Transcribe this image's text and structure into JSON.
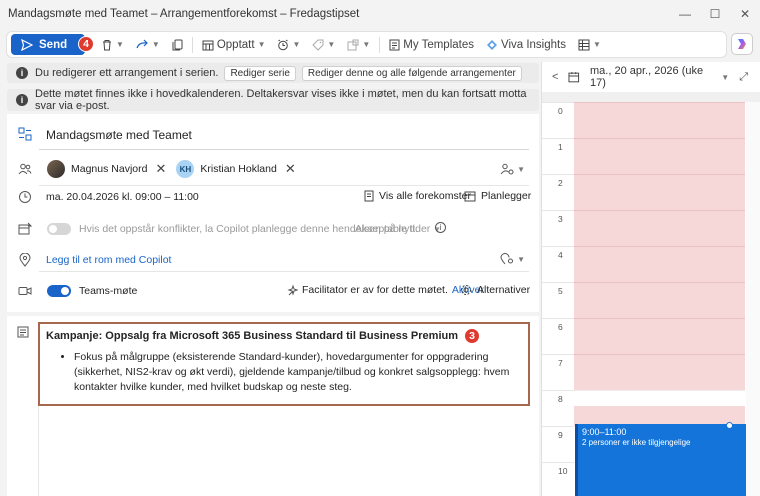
{
  "window": {
    "title": "Mandagsmøte med Teamet – Arrangementforekomst – Fredagstipset",
    "min": "—",
    "max": "☐",
    "close": "✕"
  },
  "toolbar": {
    "send_label": "Send",
    "send_badge": "4",
    "opptatt_label": "Opptatt",
    "my_templates_label": "My Templates",
    "viva_insights_label": "Viva Insights"
  },
  "notices": {
    "series_text": "Du redigerer ett arrangement i serien.",
    "edit_series_btn": "Rediger serie",
    "edit_following_btn": "Rediger denne og alle følgende arrangementer",
    "not_found_text": "Dette møtet finnes ikke i hovedkalenderen. Deltakersvar vises ikke i møtet, men du kan fortsatt motta svar via e-post."
  },
  "form": {
    "title": "Mandagsmøte med Teamet",
    "attendees": [
      {
        "name": "Magnus Navjord",
        "initials": ""
      },
      {
        "name": "Kristian Hokland",
        "initials": "KH"
      }
    ],
    "datetime": "ma. 20.04.2026 kl. 09:00 – 11:00",
    "show_all_label": "Vis alle forekomster",
    "planner_label": "Planlegger",
    "copilot_conflict_text": "Hvis det oppstår konflikter, la Copilot planlegge denne hendelsen på nytt.",
    "acceptable_times": "Akseptable tider",
    "location_link": "Legg til et rom med Copilot",
    "teams_label": "Teams-møte",
    "facilitator_text": "Facilitator er av for dette møtet.",
    "activate_link": "Aktiver",
    "alternatives_label": "Alternativer"
  },
  "body": {
    "heading": "Kampanje: Oppsalg fra Microsoft 365 Business Standard til Business Premium",
    "badge": "3",
    "bullet": "Fokus på målgruppe (eksisterende Standard-kunder), hovedargumenter for oppgradering (sikkerhet, NIS2-krav og økt verdi), gjeldende kampanje/tilbud og konkret salgsopplegg: hvem kontakter hvilke kunder, med hvilket budskap og neste steg."
  },
  "calendar": {
    "date_label": "ma., 20 apr., 2026 (uke 17)",
    "hours": [
      "0",
      "1",
      "2",
      "3",
      "4",
      "5",
      "6",
      "7",
      "8",
      "9",
      "10"
    ],
    "event_time": "9:00–11:00",
    "event_note": "2 personer er ikke tilgjengelige"
  },
  "colors": {
    "accent": "#1a64c9",
    "badge": "#e03a2f",
    "busy_slot": "#f6d8d8",
    "event": "#1474d9",
    "highlight_border": "#a5674d"
  }
}
